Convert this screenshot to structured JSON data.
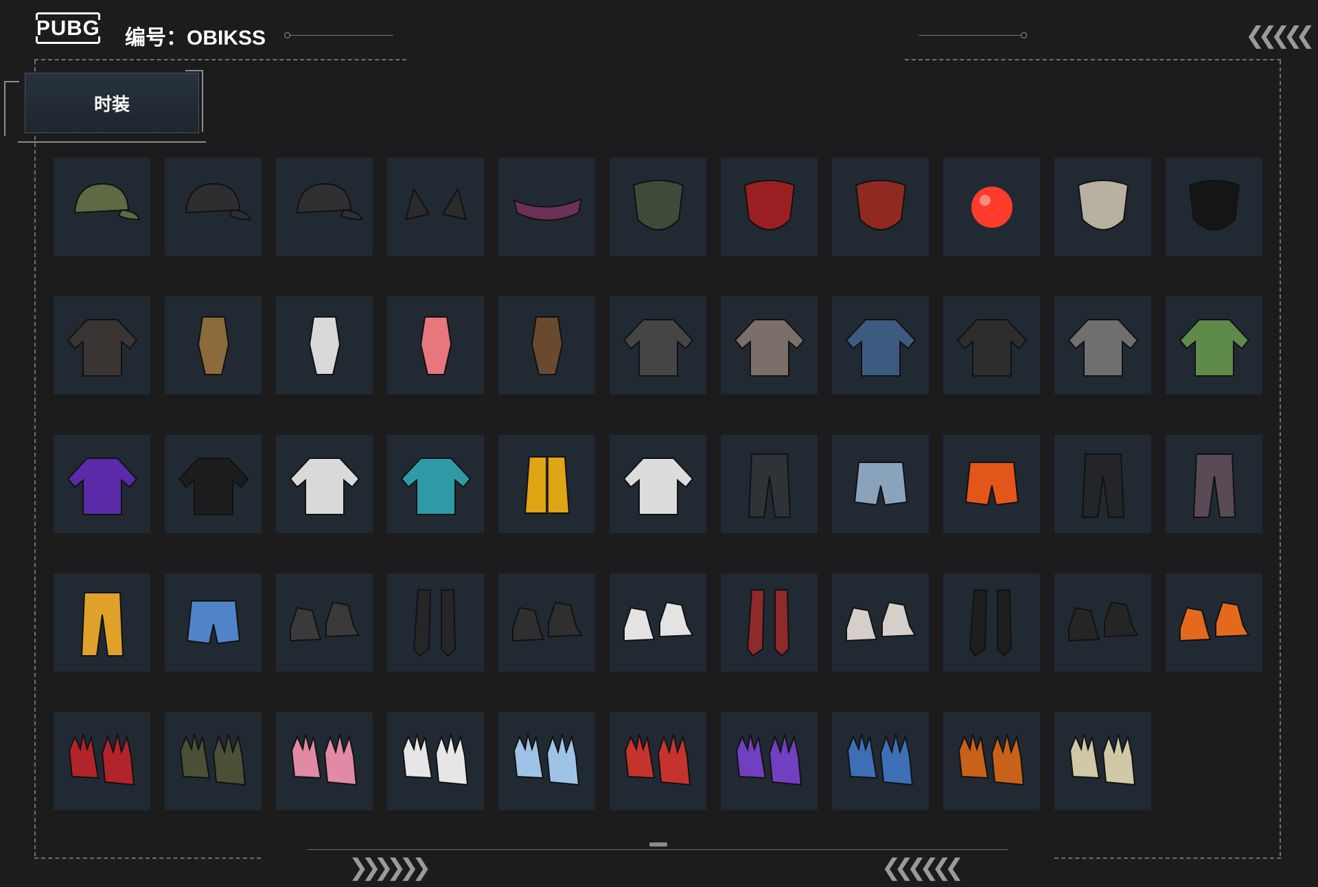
{
  "header": {
    "logo": "PUBG",
    "id_text": "编号：OBIKSS"
  },
  "tab": {
    "label": "时装"
  },
  "nav": {
    "top_right_arrows": "❮❮❮❮ ❮",
    "bottom_left_arrows": "❯❯ ❯❯❯❯",
    "bottom_right_arrows": "❮❮❮❮ ❮❮"
  },
  "colors": {
    "background": "#1c1c1d",
    "cell": "#212a33",
    "frame": "#707070"
  },
  "items": [
    {
      "icon": "headset-cap-icon",
      "c": "#5f6a44"
    },
    {
      "icon": "black-cap-icon",
      "c": "#2e2e30"
    },
    {
      "icon": "black-cap-red-logo-icon",
      "c": "#303032"
    },
    {
      "icon": "cat-ears-icon",
      "c": "#2b2b2b"
    },
    {
      "icon": "purple-visor-icon",
      "c": "#6c3157"
    },
    {
      "icon": "camo-face-mask-icon",
      "c": "#3e4a3a"
    },
    {
      "icon": "red-skull-mask-icon",
      "c": "#9a1f22"
    },
    {
      "icon": "red-bandana-icon",
      "c": "#8e2a20"
    },
    {
      "icon": "red-clown-nose-icon",
      "c": "#ff3b2b"
    },
    {
      "icon": "beige-scarf-icon",
      "c": "#b8b0a0"
    },
    {
      "icon": "shark-teeth-mask-icon",
      "c": "#151515"
    },
    {
      "icon": "off-shoulder-top-icon",
      "c": "#3a3533"
    },
    {
      "icon": "leopard-bikini-icon",
      "c": "#8b6a3c"
    },
    {
      "icon": "white-bodysuit-icon",
      "c": "#d9d9d9"
    },
    {
      "icon": "pink-plaid-swimsuit-icon",
      "c": "#e7777d"
    },
    {
      "icon": "leopard-crop-top-icon",
      "c": "#6a4a2e"
    },
    {
      "icon": "tattoo-tshirt-icon",
      "c": "#454545"
    },
    {
      "icon": "plaid-shirt-icon",
      "c": "#7b6f6a"
    },
    {
      "icon": "denim-hooded-jacket-icon",
      "c": "#3d5a80"
    },
    {
      "icon": "black-hooded-jacket-icon",
      "c": "#2d2d2d"
    },
    {
      "icon": "orange-grey-jacket-icon",
      "c": "#6f6f6f"
    },
    {
      "icon": "colorful-hoodie-icon",
      "c": "#5e8a4a"
    },
    {
      "icon": "purple-racing-jacket-icon",
      "c": "#5a2aa8"
    },
    {
      "icon": "black-hoodie-icon",
      "c": "#1d1d1d"
    },
    {
      "icon": "white-orange-jacket-icon",
      "c": "#d9d9d9"
    },
    {
      "icon": "teal-bunny-hoodie-icon",
      "c": "#2f9aa5"
    },
    {
      "icon": "yellow-puffer-vest-icon",
      "c": "#e0a515"
    },
    {
      "icon": "white-green-hoodie-icon",
      "c": "#dcdcdc"
    },
    {
      "icon": "black-cargo-pants-icon",
      "c": "#2f3236"
    },
    {
      "icon": "denim-shorts-icon",
      "c": "#8aa3bd"
    },
    {
      "icon": "orange-hot-pants-icon",
      "c": "#e3561a"
    },
    {
      "icon": "black-joggers-icon",
      "c": "#232528"
    },
    {
      "icon": "camo-pants-icon",
      "c": "#5a4a55"
    },
    {
      "icon": "yellow-sweatpants-icon",
      "c": "#e0a12a"
    },
    {
      "icon": "blue-board-shorts-icon",
      "c": "#4f84c8"
    },
    {
      "icon": "black-white-sneakers-icon",
      "c": "#3a3a3a"
    },
    {
      "icon": "black-thigh-socks-icon",
      "c": "#262626"
    },
    {
      "icon": "teal-lace-sneakers-icon",
      "c": "#2f2f2f"
    },
    {
      "icon": "white-red-sneakers-icon",
      "c": "#e3e3e3"
    },
    {
      "icon": "red-stockings-boots-icon",
      "c": "#8e2a2a"
    },
    {
      "icon": "white-canvas-shoes-icon",
      "c": "#d6cfc9"
    },
    {
      "icon": "stockings-black-boots-icon",
      "c": "#1e1e1e"
    },
    {
      "icon": "fur-black-boots-icon",
      "c": "#252525"
    },
    {
      "icon": "orange-sneakers-icon",
      "c": "#e36a1d"
    },
    {
      "icon": "red-white-gloves-icon",
      "c": "#b0242a"
    },
    {
      "icon": "camo-gloves-icon",
      "c": "#4b4f36"
    },
    {
      "icon": "pink-print-gloves-icon",
      "c": "#e08aa6"
    },
    {
      "icon": "white-cuff-gloves-icon",
      "c": "#e6e6e6"
    },
    {
      "icon": "blue-knit-fingerless-gloves-icon",
      "c": "#9ec3e6"
    },
    {
      "icon": "red-black-gloves-icon",
      "c": "#c4342c"
    },
    {
      "icon": "purple-gloves-icon",
      "c": "#7040c0"
    },
    {
      "icon": "blue-fingerless-gloves-icon",
      "c": "#3d6fb5"
    },
    {
      "icon": "orange-black-gloves-icon",
      "c": "#c8611a"
    },
    {
      "icon": "yellow-beige-gloves-icon",
      "c": "#cfc9a6"
    }
  ]
}
